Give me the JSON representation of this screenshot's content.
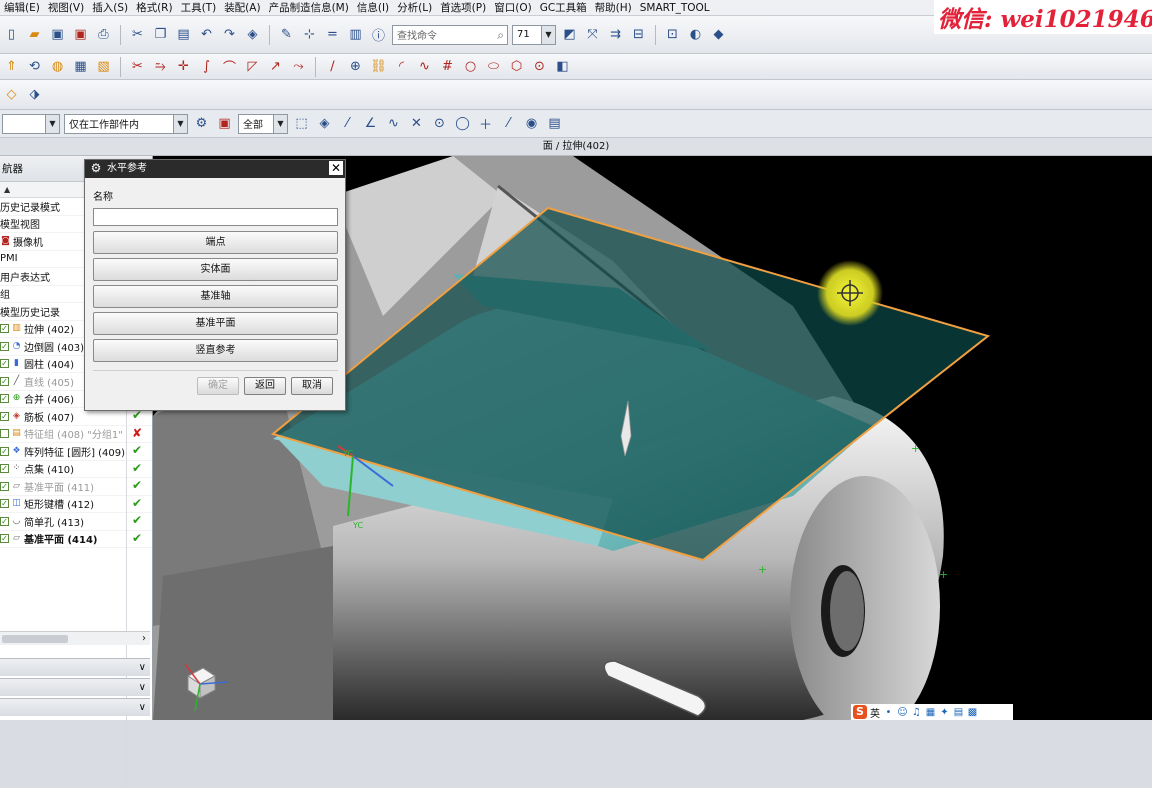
{
  "menubar": {
    "items": [
      "编辑(E)",
      "视图(V)",
      "插入(S)",
      "格式(R)",
      "工具(T)",
      "装配(A)",
      "产品制造信息(M)",
      "信息(I)",
      "分析(L)",
      "首选项(P)",
      "窗口(O)",
      "GC工具箱",
      "帮助(H)",
      "SMART_TOOL"
    ]
  },
  "watermark": {
    "text": "微信: wei1021946"
  },
  "toolbar": {
    "search_placeholder": "查找命令",
    "zoom_value": "71"
  },
  "selection_bar": {
    "filter_value": "仅在工作部件内",
    "scope_value": "全部"
  },
  "status": {
    "selected_label": "面 / 拉伸(402)"
  },
  "navigator": {
    "title": "航器",
    "items": [
      {
        "label": "历史记录模式",
        "checked": false,
        "icon": "",
        "status": ""
      },
      {
        "label": "模型视图",
        "checked": false,
        "icon": "",
        "status": ""
      },
      {
        "label": "摄像机",
        "checked": false,
        "icon": "camera-icon",
        "status": ""
      },
      {
        "label": "PMI",
        "checked": false,
        "icon": "",
        "status": ""
      },
      {
        "label": "用户表达式",
        "checked": false,
        "icon": "",
        "status": ""
      },
      {
        "label": "组",
        "checked": false,
        "icon": "",
        "status": ""
      },
      {
        "label": "模型历史记录",
        "checked": false,
        "icon": "",
        "status": ""
      },
      {
        "label": "拉伸 (402)",
        "checked": true,
        "icon": "extrude-icon",
        "status": ""
      },
      {
        "label": "边倒圆 (403)",
        "checked": true,
        "icon": "edge-blend-icon",
        "status": ""
      },
      {
        "label": "圆柱 (404)",
        "checked": true,
        "icon": "cylinder-icon",
        "status": ""
      },
      {
        "label": "直线 (405)",
        "checked": true,
        "icon": "line-icon",
        "status": "",
        "greyed": true
      },
      {
        "label": "合并 (406)",
        "checked": true,
        "icon": "unite-icon",
        "status": "ok"
      },
      {
        "label": "筋板 (407)",
        "checked": true,
        "icon": "rib-icon",
        "status": "ok"
      },
      {
        "label": "特征组 (408) \"分组1\"",
        "checked": false,
        "icon": "feature-group-icon",
        "status": "bad",
        "greyed": true
      },
      {
        "label": "阵列特征 [圆形] (409)",
        "checked": true,
        "icon": "pattern-icon",
        "status": "ok"
      },
      {
        "label": "点集 (410)",
        "checked": true,
        "icon": "point-set-icon",
        "status": "ok"
      },
      {
        "label": "基准平面 (411)",
        "checked": true,
        "icon": "datum-plane-icon",
        "status": "ok",
        "greyed": true
      },
      {
        "label": "矩形键槽 (412)",
        "checked": true,
        "icon": "slot-icon",
        "status": "ok"
      },
      {
        "label": "简单孔 (413)",
        "checked": true,
        "icon": "hole-icon",
        "status": "ok"
      },
      {
        "label": "基准平面 (414)",
        "checked": true,
        "icon": "datum-plane-icon",
        "status": "ok",
        "bold": true
      }
    ]
  },
  "dialog": {
    "title": "水平参考",
    "name_label": "名称",
    "name_value": "",
    "buttons": [
      "端点",
      "实体面",
      "基准轴",
      "基准平面",
      "竖直参考"
    ],
    "ok": "确定",
    "back": "返回",
    "cancel": "取消"
  },
  "tray": {
    "ime_mode": "英"
  },
  "colors": {
    "viewport_bg": "#000000",
    "datum_plane_fill": "#0c4a4a",
    "datum_plane_edge": "#f0a040",
    "surface_teal": "#80cccc",
    "cursor_highlight": "#e6e61e"
  }
}
